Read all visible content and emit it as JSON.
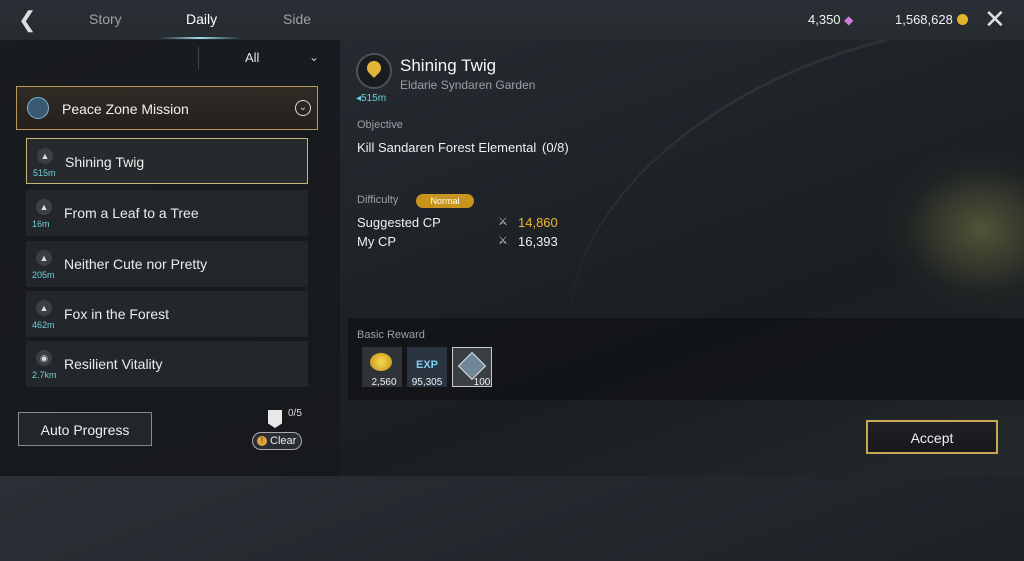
{
  "tabs": [
    {
      "label": "Story"
    },
    {
      "label": "Daily"
    },
    {
      "label": "Side"
    }
  ],
  "currency": {
    "gems": "4,350",
    "gold": "1,568,628"
  },
  "filter": {
    "selected": "All"
  },
  "group": {
    "label": "Peace Zone Mission"
  },
  "quests": [
    {
      "label": "Shining Twig",
      "distance": "515m"
    },
    {
      "label": "From a Leaf to a Tree",
      "distance": "16m"
    },
    {
      "label": "Neither Cute nor Pretty",
      "distance": "205m"
    },
    {
      "label": "Fox in the Forest",
      "distance": "462m"
    },
    {
      "label": "Resilient Vitality",
      "distance": "2.7km"
    }
  ],
  "auto_progress_label": "Auto Progress",
  "clear": {
    "count": "0/5",
    "label": "Clear"
  },
  "detail": {
    "title": "Shining Twig",
    "location": "Eldarie Syndaren Garden",
    "distance": "515m",
    "objective_label": "Objective",
    "objective": "Kill Sandaren Forest Elemental",
    "objective_progress": "(0/8)",
    "difficulty_label": "Difficulty",
    "difficulty": "Normal",
    "suggested_cp_label": "Suggested CP",
    "suggested_cp": "14,860",
    "my_cp_label": "My CP",
    "my_cp": "16,393"
  },
  "reward": {
    "label": "Basic Reward",
    "items": [
      {
        "icon": "gold-coins-icon",
        "qty": "2,560"
      },
      {
        "icon": "exp-icon",
        "name": "EXP",
        "qty": "95,305"
      },
      {
        "icon": "crystal-icon",
        "qty": "100"
      }
    ]
  },
  "accept_label": "Accept",
  "colors": {
    "accent_gold": "#c7a855",
    "cp_highlight": "#f2b531",
    "distance": "#6dd0d6"
  }
}
